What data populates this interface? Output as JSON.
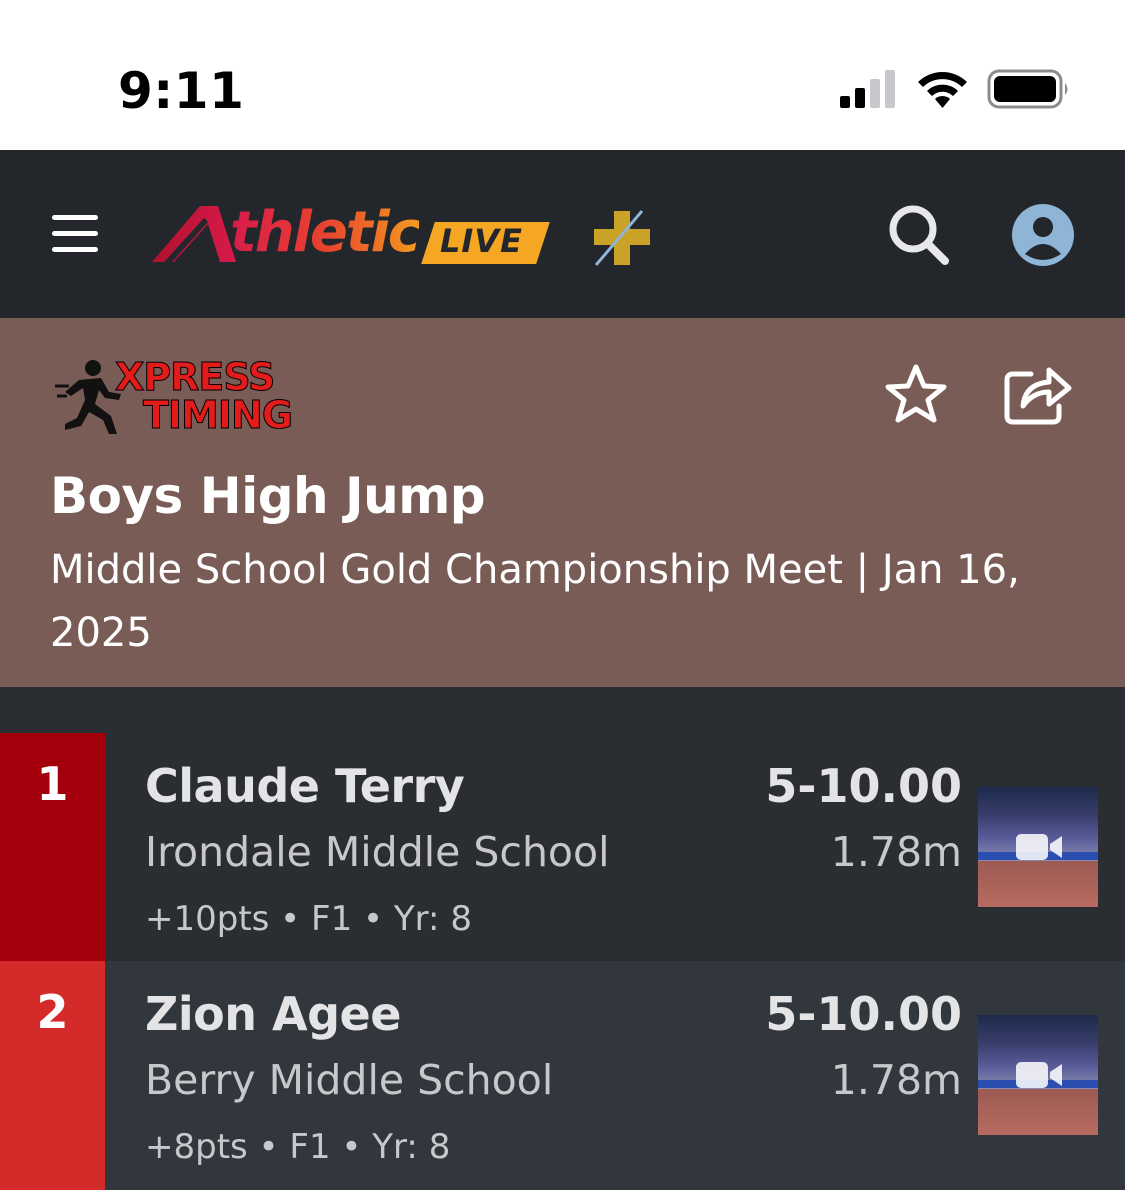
{
  "status_bar": {
    "time": "9:11"
  },
  "header": {
    "logo_main": "thletic",
    "logo_badge": "LIVE"
  },
  "event": {
    "timer_logo_line1": "XPRESS",
    "timer_logo_line2": "TIMING",
    "title": "Boys High Jump",
    "subtitle": "Middle School Gold Championship Meet | Jan 16, 2025"
  },
  "results": [
    {
      "place": "1",
      "name": "Claude Terry",
      "school": "Irondale Middle School",
      "meta": "+10pts • F1 • Yr: 8",
      "mark_imperial": "5-10.00",
      "mark_metric": "1.78m",
      "place_color": "#a3000b"
    },
    {
      "place": "2",
      "name": "Zion Agee",
      "school": "Berry Middle School",
      "meta": "+8pts • F1 • Yr: 8",
      "mark_imperial": "5-10.00",
      "mark_metric": "1.78m",
      "place_color": "#d42a2a"
    }
  ],
  "colors": {
    "header_bg": "#23262b",
    "banner_bg": "#7a5c57",
    "row1_bg": "#2a2d32",
    "row2_bg": "#32363d",
    "profile_icon": "#8eb4d6"
  },
  "icons": [
    "menu-icon",
    "search-icon",
    "profile-icon",
    "star-icon",
    "share-icon",
    "video-camera-icon"
  ]
}
